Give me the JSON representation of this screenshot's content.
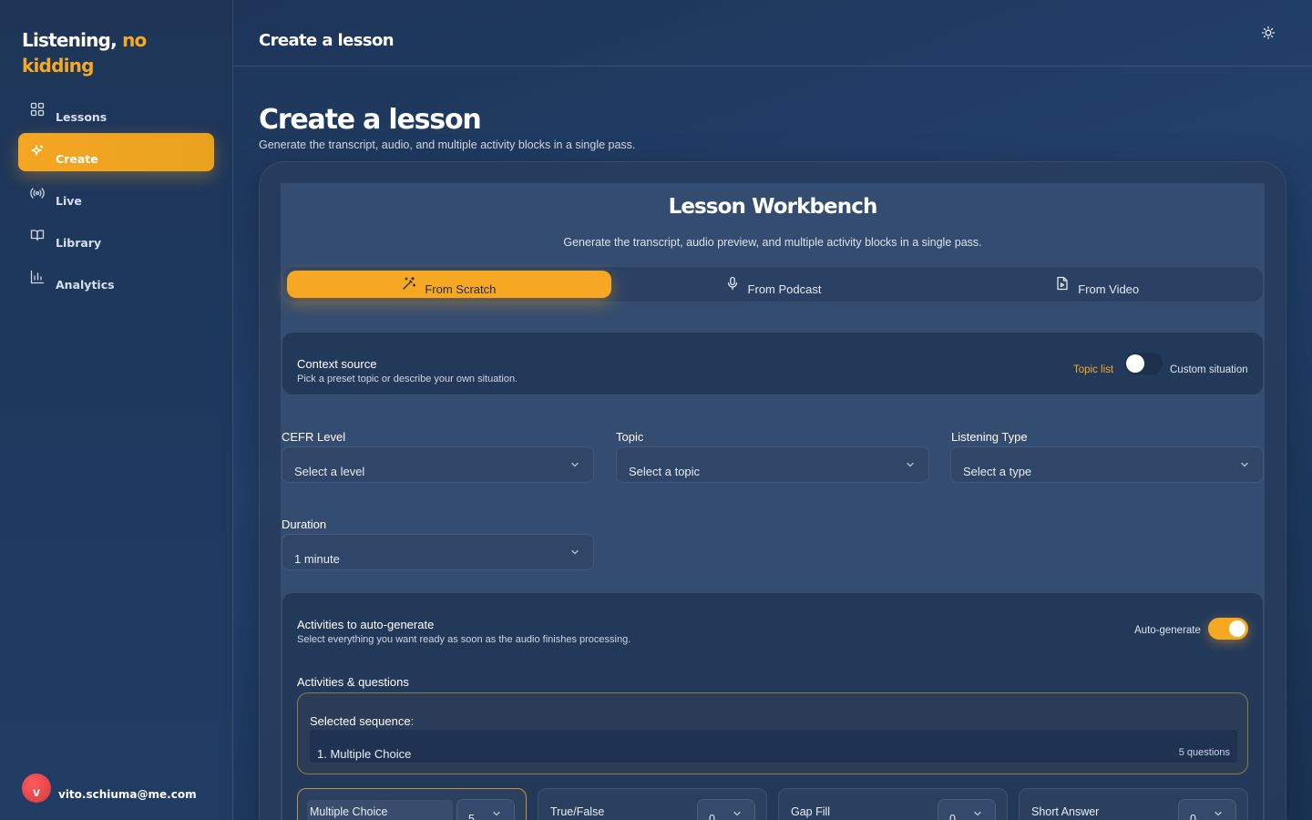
{
  "brand": {
    "line1": "Listening,",
    "accent1": "no",
    "line2": "kidding"
  },
  "nav": [
    {
      "label": "Lessons",
      "icon": "grid-icon",
      "active": false
    },
    {
      "label": "Create",
      "icon": "sparkles-icon",
      "active": true
    },
    {
      "label": "Live",
      "icon": "broadcast-icon",
      "active": false
    },
    {
      "label": "Library",
      "icon": "book-open-icon",
      "active": false
    },
    {
      "label": "Analytics",
      "icon": "bar-chart-icon",
      "active": false
    }
  ],
  "user": {
    "initial": "v",
    "email": "vito.schiuma@me.com"
  },
  "topbar": {
    "title": "Create a lesson",
    "theme_icon": "sun-icon"
  },
  "page": {
    "title": "Create a lesson",
    "subtitle": "Generate the transcript, audio, and multiple activity blocks in a single pass."
  },
  "workbench": {
    "title": "Lesson Workbench",
    "subtitle": "Generate the transcript, audio preview, and multiple activity blocks in a single pass.",
    "tabs": [
      {
        "label": "From Scratch",
        "icon": "magic-wand-icon",
        "active": true
      },
      {
        "label": "From Podcast",
        "icon": "microphone-icon",
        "active": false
      },
      {
        "label": "From Video",
        "icon": "file-video-icon",
        "active": false
      }
    ],
    "context": {
      "title": "Context source",
      "description": "Pick a preset topic or describe your own situation.",
      "left_option": "Topic list",
      "right_option": "Custom situation",
      "toggle_on": false
    },
    "fields": {
      "cefr": {
        "label": "CEFR Level",
        "value": "Select a level"
      },
      "topic": {
        "label": "Topic",
        "value": "Select a topic"
      },
      "listening_type": {
        "label": "Listening Type",
        "value": "Select a type"
      },
      "duration": {
        "label": "Duration",
        "value": "1 minute"
      }
    },
    "activities": {
      "title": "Activities to auto-generate",
      "description": "Select everything you want ready as soon as the audio finishes processing.",
      "auto_label": "Auto-generate",
      "auto_on": true,
      "section_label": "Activities & questions",
      "sequence_title": "Selected sequence:",
      "sequence": [
        {
          "name": "1. Multiple Choice",
          "count": "5 questions"
        }
      ],
      "tiles": [
        {
          "name": "Multiple Choice",
          "qty": "5",
          "selected": true
        },
        {
          "name": "True/False",
          "qty": "0",
          "selected": false
        },
        {
          "name": "Gap Fill",
          "qty": "0",
          "selected": false
        },
        {
          "name": "Short Answer",
          "qty": "0",
          "selected": false
        }
      ]
    }
  },
  "colors": {
    "accent": "#f6a823",
    "background": "#1d3355",
    "card": "#344c70"
  }
}
